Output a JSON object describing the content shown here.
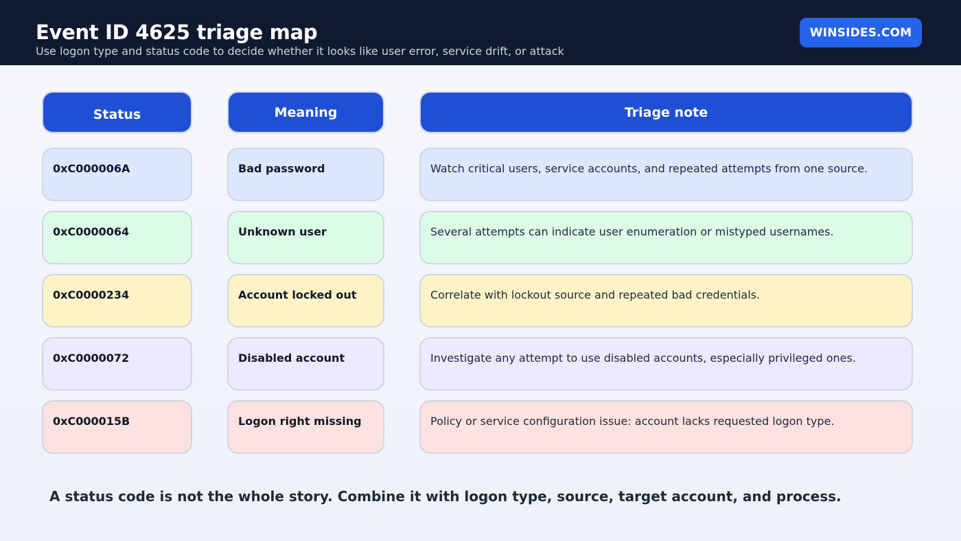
{
  "header": {
    "title": "Event ID 4625 triage map",
    "subtitle": "Use logon type and status code to decide whether it looks like user error, service drift, or attack",
    "brand": "WINSIDES.COM"
  },
  "table": {
    "columns": [
      "Status",
      "Meaning",
      "Triage note"
    ],
    "rows": [
      {
        "status": "0xC000006A",
        "meaning": "Bad password",
        "note": "Watch critical users, service accounts, and repeated attempts from one source.",
        "color": "#dbe8fe"
      },
      {
        "status": "0xC0000064",
        "meaning": "Unknown user",
        "note": "Several attempts can indicate user enumeration or mistyped usernames.",
        "color": "#dcfce7"
      },
      {
        "status": "0xC0000234",
        "meaning": "Account locked out",
        "note": "Correlate with lockout source and repeated bad credentials.",
        "color": "#fef3c7"
      },
      {
        "status": "0xC0000072",
        "meaning": "Disabled account",
        "note": "Investigate any attempt to use disabled accounts, especially privileged ones.",
        "color": "#ede9fe"
      },
      {
        "status": "0xC000015B",
        "meaning": "Logon right missing",
        "note": "Policy or service configuration issue: account lacks requested logon type.",
        "color": "#fee2e2"
      }
    ]
  },
  "footer": "A status code is not the whole story. Combine it with logon type, source, target account, and process.",
  "colors": {
    "header_bg": "#101a2e",
    "accent": "#2563eb",
    "column_header": "#1f4fd6"
  }
}
